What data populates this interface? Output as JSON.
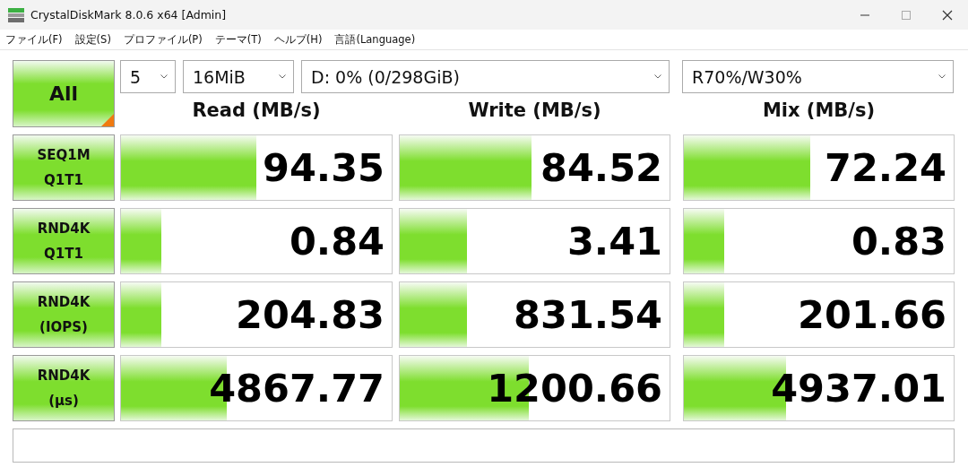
{
  "window": {
    "title": "CrystalDiskMark 8.0.6 x64 [Admin]"
  },
  "menu": [
    "ファイル(F)",
    "設定(S)",
    "プロファイル(P)",
    "テーマ(T)",
    "ヘルプ(H)",
    "言語(Language)"
  ],
  "all_button": {
    "label": "All"
  },
  "selects": [
    {
      "value": "5"
    },
    {
      "value": "16MiB"
    },
    {
      "value": "D: 0% (0/298GiB)"
    },
    {
      "value": "R70%/W30%"
    }
  ],
  "headers": [
    "Read (MB/s)",
    "Write (MB/s)",
    "Mix (MB/s)"
  ],
  "rows": [
    {
      "label": "SEQ1M\nQ1T1",
      "results": [
        {
          "value": "94.35",
          "level": 0.5
        },
        {
          "value": "84.52",
          "level": 0.49
        },
        {
          "value": "72.24",
          "level": 0.47
        }
      ]
    },
    {
      "label": "RND4K\nQ1T1",
      "results": [
        {
          "value": "0.84",
          "level": 0.15
        },
        {
          "value": "3.41",
          "level": 0.25
        },
        {
          "value": "0.83",
          "level": 0.15
        }
      ]
    },
    {
      "label": "RND4K\n(IOPS)",
      "results": [
        {
          "value": "204.83",
          "level": 0.15
        },
        {
          "value": "831.54",
          "level": 0.25
        },
        {
          "value": "201.66",
          "level": 0.15
        }
      ]
    },
    {
      "label": "RND4K\n(µs)",
      "results": [
        {
          "value": "4867.77",
          "level": 0.39
        },
        {
          "value": "1200.66",
          "level": 0.48
        },
        {
          "value": "4937.01",
          "level": 0.38
        }
      ]
    }
  ]
}
